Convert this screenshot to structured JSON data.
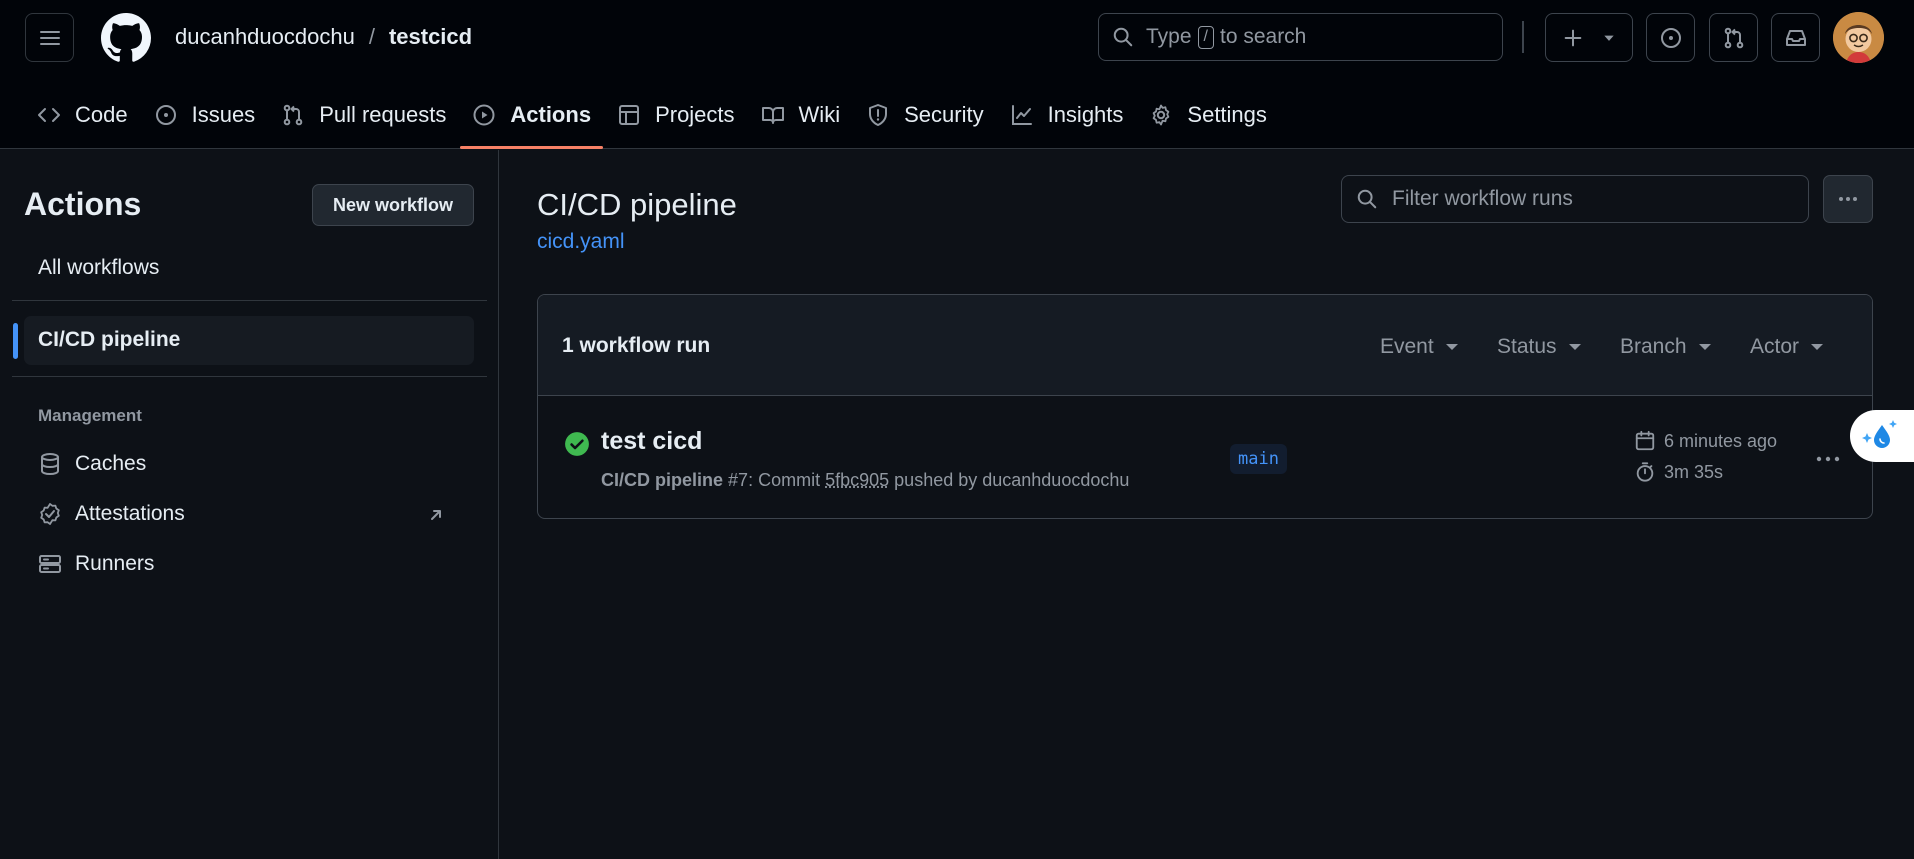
{
  "header": {
    "owner": "ducanhduocdochu",
    "separator": "/",
    "repo": "testcicd",
    "search": {
      "prefix": "Type",
      "key": "/",
      "suffix": "to search"
    }
  },
  "repo_nav": {
    "items": [
      {
        "label": "Code",
        "icon": "code-icon"
      },
      {
        "label": "Issues",
        "icon": "issue-icon"
      },
      {
        "label": "Pull requests",
        "icon": "pull-request-icon"
      },
      {
        "label": "Actions",
        "icon": "play-icon",
        "active": true
      },
      {
        "label": "Projects",
        "icon": "table-icon"
      },
      {
        "label": "Wiki",
        "icon": "book-icon"
      },
      {
        "label": "Security",
        "icon": "shield-icon"
      },
      {
        "label": "Insights",
        "icon": "graph-icon"
      },
      {
        "label": "Settings",
        "icon": "gear-icon"
      }
    ]
  },
  "sidebar": {
    "title": "Actions",
    "new_workflow": "New workflow",
    "all_workflows": "All workflows",
    "selected_workflow": "CI/CD pipeline",
    "management_heading": "Management",
    "management": [
      {
        "label": "Caches",
        "icon": "database-icon"
      },
      {
        "label": "Attestations",
        "icon": "verified-icon"
      },
      {
        "label": "Runners",
        "icon": "server-icon"
      }
    ]
  },
  "main": {
    "title": "CI/CD pipeline",
    "file": "cicd.yaml",
    "filter_placeholder": "Filter workflow runs",
    "runs_count": "1 workflow run",
    "filters": [
      "Event",
      "Status",
      "Branch",
      "Actor"
    ],
    "runs": [
      {
        "name": "test cicd",
        "status": "success",
        "workflow": "CI/CD pipeline",
        "number": "#7",
        "commit_prefix": "Commit",
        "sha": "5fbc905",
        "pushed_by": "pushed by ducanhduocdochu",
        "branch": "main",
        "when": "6 minutes ago",
        "duration": "3m 35s"
      }
    ]
  },
  "colors": {
    "accent": "#4493f8",
    "success": "#3fb950",
    "active_tab": "#f78166"
  }
}
